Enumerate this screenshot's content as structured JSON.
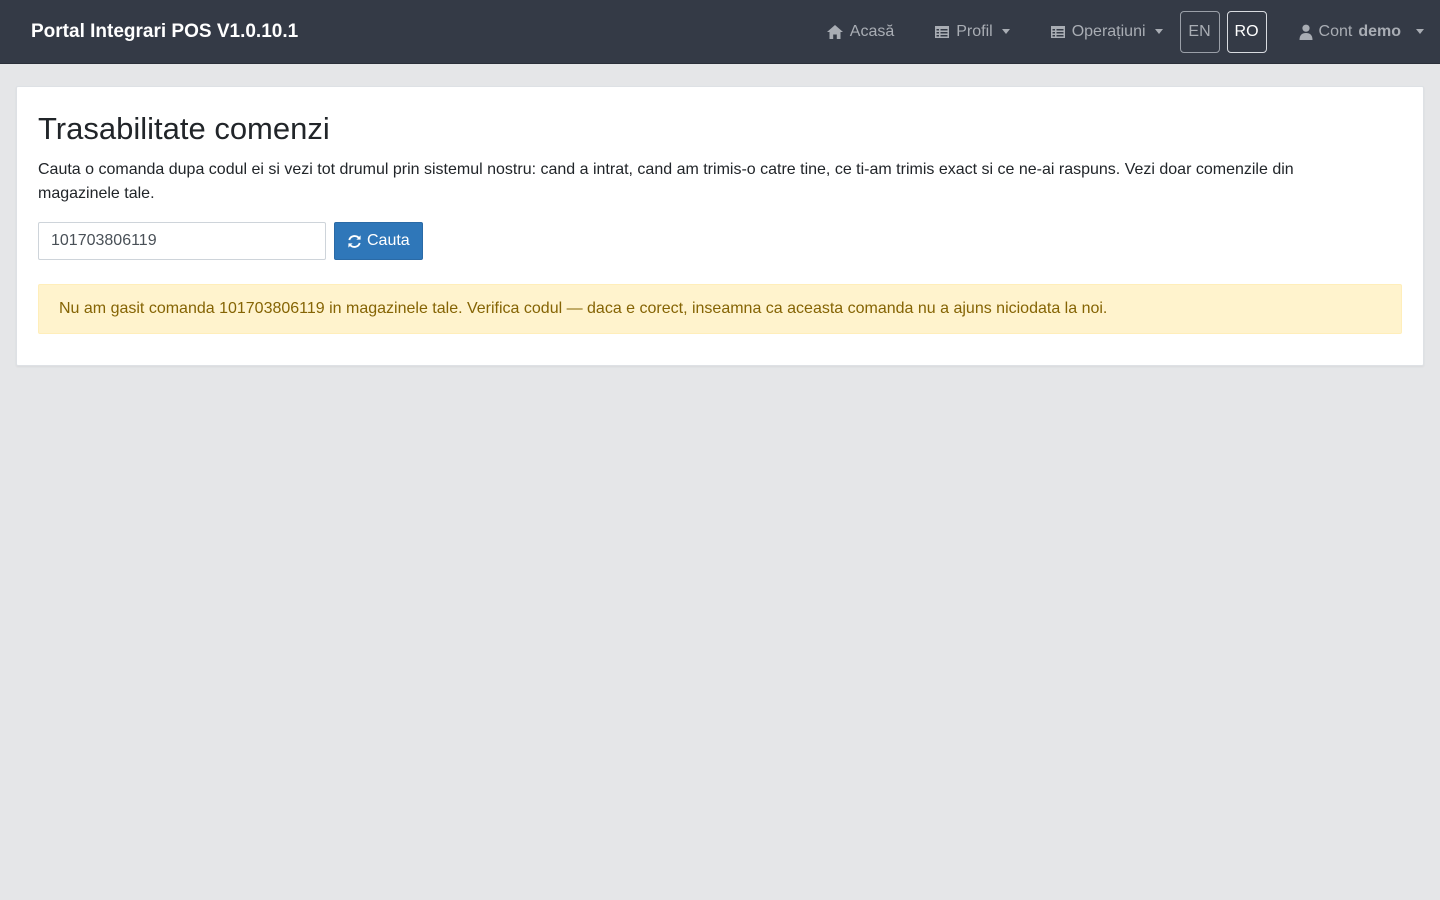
{
  "navbar": {
    "brand": "Portal Integrari POS V1.0.10.1",
    "home_label": "Acasă",
    "profile_label": "Profil",
    "operations_label": "Operațiuni",
    "lang_en": "EN",
    "lang_ro": "RO",
    "account_prefix": "Cont",
    "account_user": "demo"
  },
  "main": {
    "title": "Trasabilitate comenzi",
    "description": "Cauta o comanda dupa codul ei si vezi tot drumul prin sistemul nostru: cand a intrat, cand am trimis-o catre tine, ce ti-am trimis exact si ce ne-ai raspuns. Vezi doar comenzile din magazinele tale.",
    "search": {
      "value": "101703806119",
      "button_label": "Cauta"
    },
    "alert": "Nu am gasit comanda 101703806119 in magazinele tale. Verifica codul — daca e corect, inseamna ca aceasta comanda nu a ajuns niciodata la noi."
  },
  "colors": {
    "navbar_bg": "#343a46",
    "primary": "#2f77b9",
    "alert_bg": "#fff3cd",
    "alert_text": "#856404"
  },
  "icons": {
    "home": "home-icon",
    "profile": "table-icon",
    "operations": "table-icon",
    "account": "user-icon",
    "search_button": "refresh-icon"
  }
}
